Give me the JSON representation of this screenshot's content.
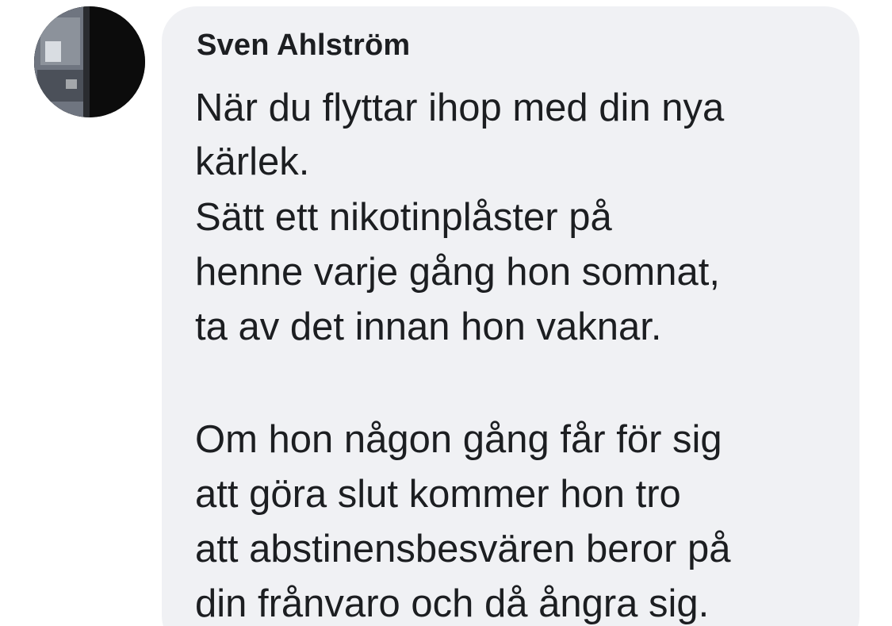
{
  "comment": {
    "author": "Sven Ahlström",
    "lines": [
      "När du flyttar ihop med din nya",
      "kärlek.",
      "Sätt ett nikotinplåster på",
      "henne varje gång hon somnat,",
      "ta av det innan hon vaknar.",
      "Om hon någon gång får för sig",
      "att göra slut kommer hon tro",
      "att abstinensbesvären beror på",
      "din frånvaro och då ångra sig."
    ]
  },
  "colors": {
    "bubble_background": "#f0f1f4",
    "text": "#1c1e21"
  }
}
